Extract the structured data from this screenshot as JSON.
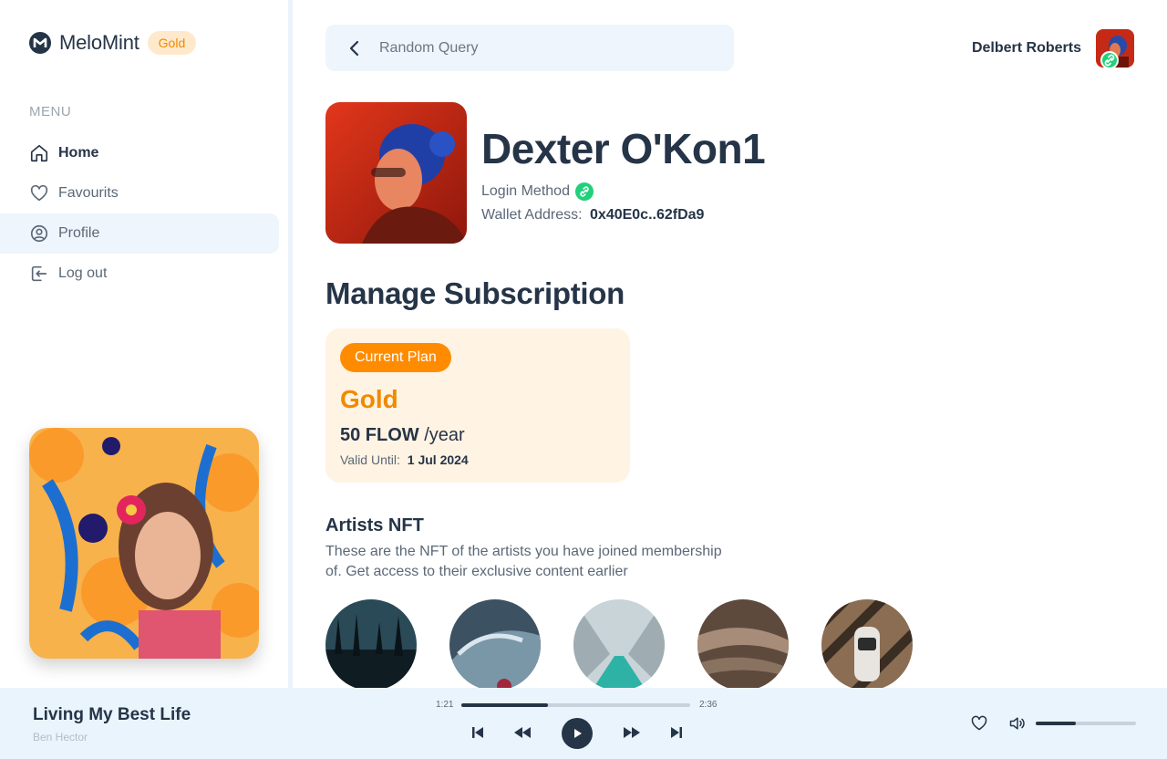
{
  "app": {
    "name": "MeloMint",
    "tier_badge": "Gold"
  },
  "sidebar": {
    "menu_label": "MENU",
    "items": [
      {
        "label": "Home",
        "icon": "home-icon"
      },
      {
        "label": "Favourits",
        "icon": "heart-icon"
      },
      {
        "label": "Profile",
        "icon": "user-circle-icon"
      },
      {
        "label": "Log out",
        "icon": "logout-icon"
      }
    ]
  },
  "header": {
    "search": {
      "placeholder": "Random Query"
    },
    "user": {
      "name": "Delbert Roberts"
    }
  },
  "profile": {
    "name": "Dexter O'Kon1",
    "login_method_label": "Login Method",
    "wallet_label": "Wallet Address:",
    "wallet_value": "0x40E0c..62fDa9"
  },
  "subscription": {
    "title": "Manage Subscription",
    "badge": "Current Plan",
    "plan": "Gold",
    "price": "50 FLOW",
    "period": "/year",
    "valid_label": "Valid Until:",
    "valid_value": "1 Jul  2024"
  },
  "nft": {
    "title": "Artists NFT",
    "description": "These are the NFT of the artists you have joined membership of. Get access to their exclusive content earlier",
    "items": [
      "forest-nft",
      "car-nft",
      "pier-nft",
      "rock-nft",
      "car-top-nft"
    ]
  },
  "player": {
    "title": "Living My Best Life",
    "artist": "Ben Hector",
    "elapsed": "1:21",
    "duration": "2:36",
    "progress": 0.38,
    "volume": 0.4
  },
  "colors": {
    "primary": "#253447",
    "accent": "#ff8c00",
    "accent_soft": "#fff3e3",
    "highlight": "#eef5fc",
    "status_green": "#1fd17a"
  }
}
